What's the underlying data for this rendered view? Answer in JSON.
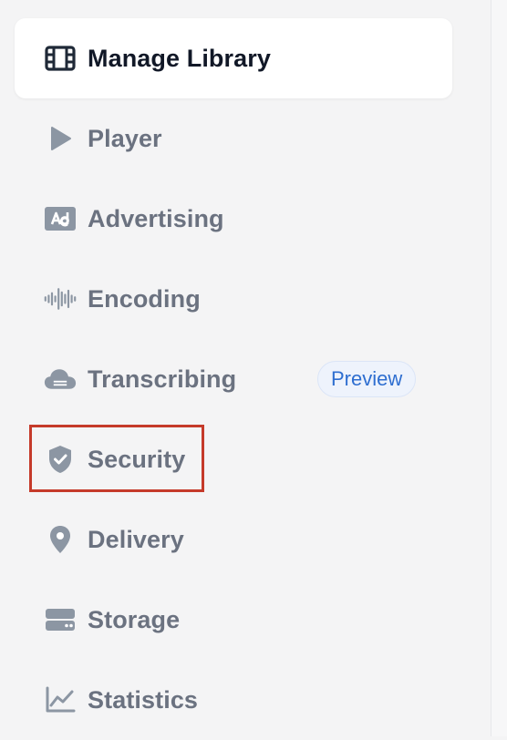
{
  "sidebar": {
    "items": [
      {
        "label": "Manage Library",
        "icon": "film-icon",
        "active": true
      },
      {
        "label": "Player",
        "icon": "play-icon"
      },
      {
        "label": "Advertising",
        "icon": "ad-icon"
      },
      {
        "label": "Encoding",
        "icon": "waveform-icon"
      },
      {
        "label": "Transcribing",
        "icon": "cloud-icon",
        "badge": "Preview"
      },
      {
        "label": "Security",
        "icon": "shield-check-icon",
        "highlighted": true
      },
      {
        "label": "Delivery",
        "icon": "location-pin-icon"
      },
      {
        "label": "Storage",
        "icon": "storage-icon"
      },
      {
        "label": "Statistics",
        "icon": "chart-icon"
      }
    ]
  },
  "colors": {
    "active_text": "#111827",
    "inactive_text": "#6b7280",
    "icon_gray": "#8c96a3",
    "badge_text": "#2e6ed0",
    "highlight_border": "#c53a2a"
  }
}
